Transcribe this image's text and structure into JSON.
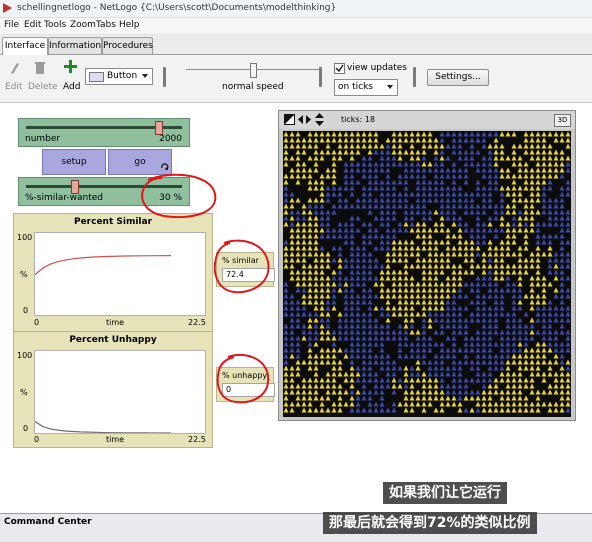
{
  "window": {
    "title": "schellingnetlogo - NetLogo {C:\\Users\\scott\\Documents\\modelthinking}"
  },
  "menu": [
    "File",
    "Edit",
    "Tools",
    "Zoom",
    "Tabs",
    "Help"
  ],
  "tabs": [
    {
      "label": "Interface",
      "active": true
    },
    {
      "label": "Information",
      "active": false
    },
    {
      "label": "Procedures",
      "active": false
    }
  ],
  "toolbar": {
    "edit": "Edit",
    "delete": "Delete",
    "add": "Add",
    "widget_type": "Button",
    "speed_label": "normal speed",
    "view_updates": "view updates",
    "view_updates_checked": true,
    "update_mode": "on ticks",
    "settings": "Settings..."
  },
  "widgets": {
    "number": {
      "label": "number",
      "value": "2000",
      "min": 0,
      "max": 2300,
      "fraction": 0.86
    },
    "setup": "setup",
    "go": "go",
    "similar_wanted": {
      "label": "%-similar-wanted",
      "value": "30 %",
      "fraction": 0.3
    }
  },
  "plots": {
    "similar": {
      "title": "Percent Similar",
      "ymax": "100",
      "ymin": "0",
      "xmin": "0",
      "xmax": "22.5",
      "xlabel": "time",
      "ylabel": "%",
      "color": "#d45050"
    },
    "unhappy": {
      "title": "Percent Unhappy",
      "ymax": "100",
      "ymin": "0",
      "xmin": "0",
      "xmax": "22.5",
      "xlabel": "time",
      "ylabel": "%",
      "color": "#707070"
    }
  },
  "monitors": {
    "similar": {
      "label": "% similar",
      "value": "72.4"
    },
    "unhappy": {
      "label": "% unhappy",
      "value": "0"
    }
  },
  "view": {
    "ticks_label": "ticks: 18",
    "btn_3d": "3D"
  },
  "command_center": "Command Center",
  "subtitles": [
    "如果我们让它运行",
    "那最后就会得到72%的类似比例"
  ],
  "colors": {
    "agent_a": "#e8d33a",
    "agent_b": "#3b4aa8",
    "background": "#0c0c0c",
    "annotation": "#e0161b"
  },
  "chart_data": [
    {
      "type": "line",
      "title": "Percent Similar",
      "xlabel": "time",
      "ylabel": "%",
      "xlim": [
        0,
        22.5
      ],
      "ylim": [
        0,
        100
      ],
      "series": [
        {
          "x": [
            0,
            1,
            2,
            3,
            4,
            5,
            6,
            8,
            10,
            12,
            14,
            16,
            18
          ],
          "values": [
            49,
            57,
            62,
            65,
            67,
            68.5,
            69.5,
            70.8,
            71.5,
            71.9,
            72.2,
            72.3,
            72.4
          ]
        }
      ]
    },
    {
      "type": "line",
      "title": "Percent Unhappy",
      "xlabel": "time",
      "ylabel": "%",
      "xlim": [
        0,
        22.5
      ],
      "ylim": [
        0,
        100
      ],
      "series": [
        {
          "x": [
            0,
            1,
            2,
            3,
            4,
            5,
            6,
            8,
            10,
            12,
            14,
            16,
            18
          ],
          "values": [
            14,
            8,
            5,
            3.5,
            2.5,
            1.8,
            1.3,
            0.8,
            0.4,
            0.2,
            0.1,
            0.05,
            0
          ]
        }
      ]
    }
  ]
}
